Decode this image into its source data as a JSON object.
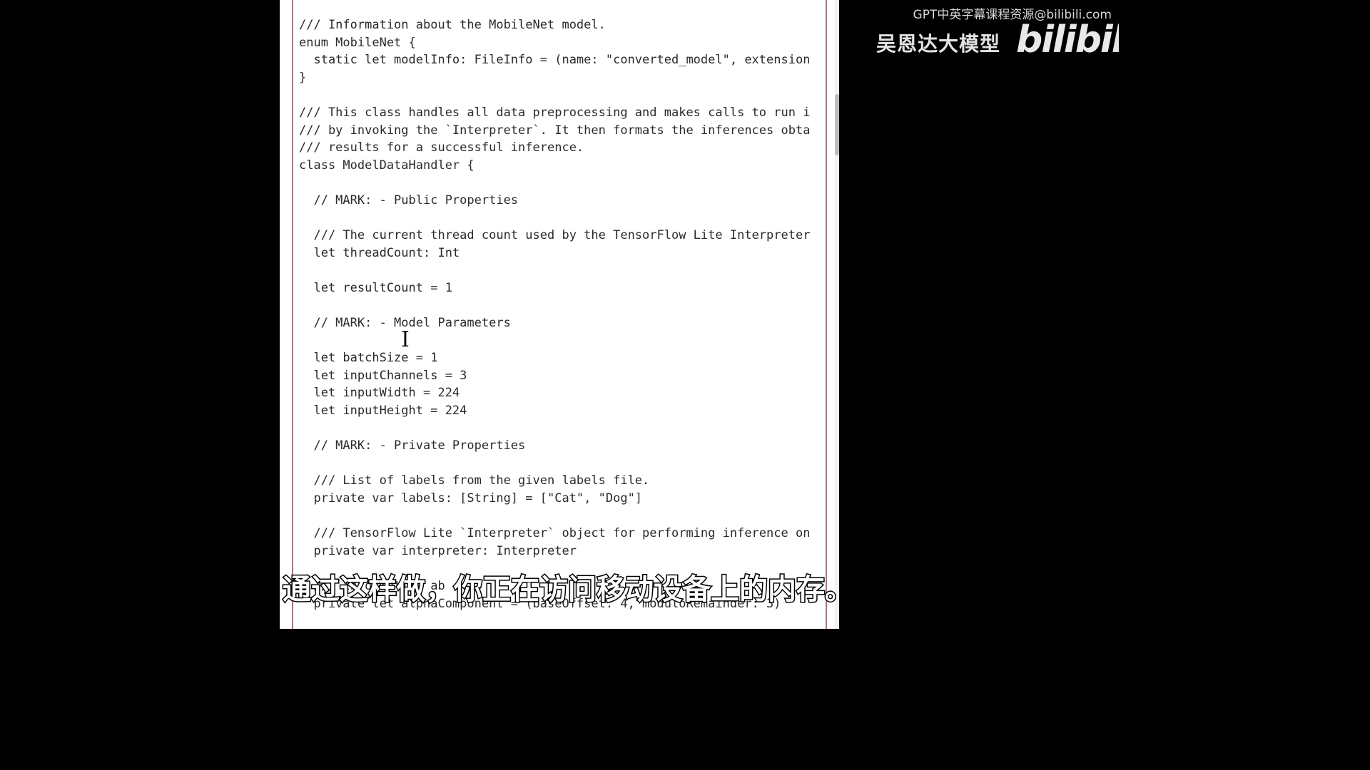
{
  "watermark": {
    "top_text": "GPT中英字幕课程资源@bilibili.com",
    "brand": "吴恩达大模型",
    "logo": "bilibili"
  },
  "editor": {
    "lines": [
      "/// Information about the MobileNet model.",
      "enum MobileNet {",
      "  static let modelInfo: FileInfo = (name: \"converted_model\", extension",
      "}",
      "",
      "/// This class handles all data preprocessing and makes calls to run i",
      "/// by invoking the `Interpreter`. It then formats the inferences obta",
      "/// results for a successful inference.",
      "class ModelDataHandler {",
      "",
      "  // MARK: - Public Properties",
      "",
      "  /// The current thread count used by the TensorFlow Lite Interpreter",
      "  let threadCount: Int",
      "",
      "  let resultCount = 1",
      "",
      "  // MARK: - Model Parameters",
      "",
      "  let batchSize = 1",
      "  let inputChannels = 3",
      "  let inputWidth = 224",
      "  let inputHeight = 224",
      "",
      "  // MARK: - Private Properties",
      "",
      "  /// List of labels from the given labels file.",
      "  private var labels: [String] = [\"Cat\", \"Dog\"]",
      "",
      "  /// TensorFlow Lite `Interpreter` object for performing inference on",
      "  private var interpreter: Interpreter",
      "",
      "  /// Information ab",
      "  private let alphaComponent = (baseOffset: 4, moduloRemainder: 3)"
    ]
  },
  "subtitle": {
    "text": "通过这样做，你正在访问移动设备上的内存。"
  }
}
